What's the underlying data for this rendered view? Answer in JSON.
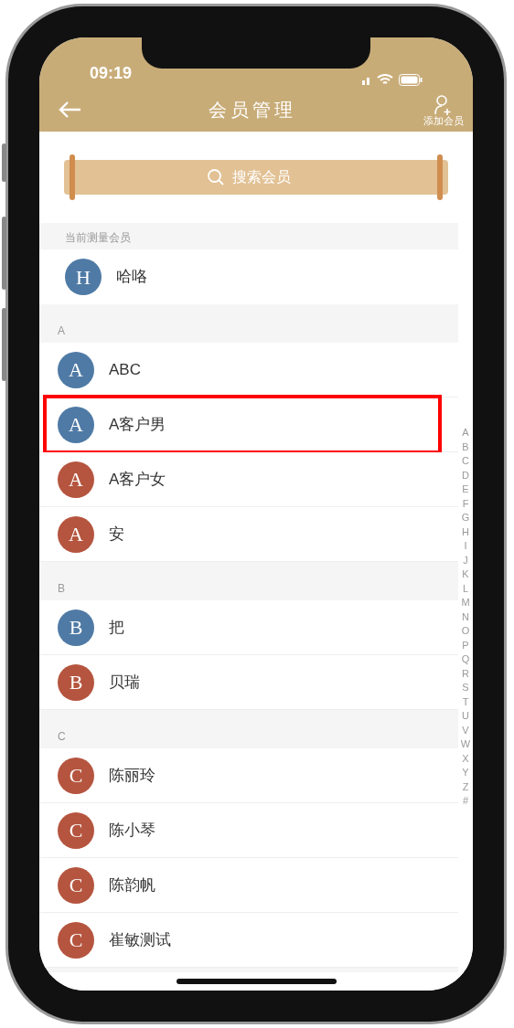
{
  "status_bar": {
    "time": "09:19"
  },
  "nav": {
    "title": "会员管理",
    "add_label": "添加会员"
  },
  "search": {
    "placeholder": "搜索会员"
  },
  "sections": [
    {
      "title": "当前测量会员",
      "members": [
        {
          "initial": "H",
          "name": "哈咯",
          "color": "#4f7aa5",
          "highlighted": false
        }
      ]
    },
    {
      "title": "A",
      "members": [
        {
          "initial": "A",
          "name": "ABC",
          "color": "#4f7aa5",
          "highlighted": false
        },
        {
          "initial": "A",
          "name": "A客户男",
          "color": "#4f7aa5",
          "highlighted": true
        },
        {
          "initial": "A",
          "name": "A客户女",
          "color": "#b5553f",
          "highlighted": false
        },
        {
          "initial": "A",
          "name": "安",
          "color": "#b5553f",
          "highlighted": false
        }
      ]
    },
    {
      "title": "B",
      "members": [
        {
          "initial": "B",
          "name": "把",
          "color": "#4f7aa5",
          "highlighted": false
        },
        {
          "initial": "B",
          "name": "贝瑞",
          "color": "#b5553f",
          "highlighted": false
        }
      ]
    },
    {
      "title": "C",
      "members": [
        {
          "initial": "C",
          "name": "陈丽玲",
          "color": "#b5553f",
          "highlighted": false
        },
        {
          "initial": "C",
          "name": "陈小琴",
          "color": "#b5553f",
          "highlighted": false
        },
        {
          "initial": "C",
          "name": "陈韵帆",
          "color": "#b5553f",
          "highlighted": false
        },
        {
          "initial": "C",
          "name": "崔敏测试",
          "color": "#b5553f",
          "highlighted": false
        }
      ]
    }
  ],
  "index_letters": [
    "A",
    "B",
    "C",
    "D",
    "E",
    "F",
    "G",
    "H",
    "I",
    "J",
    "K",
    "L",
    "M",
    "N",
    "O",
    "P",
    "Q",
    "R",
    "S",
    "T",
    "U",
    "V",
    "W",
    "X",
    "Y",
    "Z",
    "#"
  ]
}
